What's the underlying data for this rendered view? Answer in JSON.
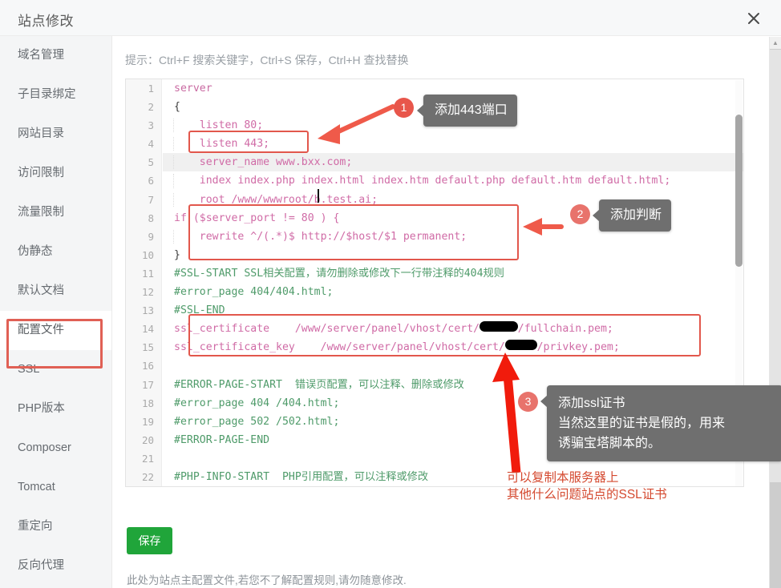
{
  "window": {
    "title": "站点修改",
    "close_icon": "close-icon"
  },
  "sidebar": {
    "items": [
      {
        "label": "域名管理",
        "active": false
      },
      {
        "label": "子目录绑定",
        "active": false
      },
      {
        "label": "网站目录",
        "active": false
      },
      {
        "label": "访问限制",
        "active": false
      },
      {
        "label": "流量限制",
        "active": false
      },
      {
        "label": "伪静态",
        "active": false
      },
      {
        "label": "默认文档",
        "active": false
      },
      {
        "label": "配置文件",
        "active": true
      },
      {
        "label": "SSL",
        "active": false
      },
      {
        "label": "PHP版本",
        "active": false
      },
      {
        "label": "Composer",
        "active": false
      },
      {
        "label": "Tomcat",
        "active": false
      },
      {
        "label": "重定向",
        "active": false
      },
      {
        "label": "反向代理",
        "active": false
      }
    ]
  },
  "main": {
    "hint": "提示：Ctrl+F 搜索关键字，Ctrl+S 保存，Ctrl+H 查找替换",
    "save_label": "保存",
    "footer_note": "此处为站点主配置文件,若您不了解配置规则,请勿随意修改."
  },
  "editor": {
    "active_line": 5,
    "line_numbers": [
      1,
      2,
      3,
      4,
      5,
      6,
      7,
      8,
      9,
      10,
      11,
      12,
      13,
      14,
      15,
      16,
      17,
      18,
      19,
      20,
      21,
      22
    ],
    "lines": [
      "server",
      "{",
      "    listen 80;",
      "    listen 443;",
      "    server_name www.bxx.com;",
      "    index index.php index.html index.htm default.php default.htm default.html;",
      "    root /www/wwwroot/b.test.ai;",
      "if ($server_port != 80 ) {",
      "    rewrite ^/(.*)$ http://$host/$1 permanent;",
      "}",
      "#SSL-START SSL相关配置，请勿删除或修改下一行带注释的404规则",
      "#error_page 404/404.html;",
      "#SSL-END",
      "ssl_certificate    /www/server/panel/vhost/cert/██████/fullchain.pem;",
      "ssl_certificate_key    /www/server/panel/vhost/cert/█████/privkey.pem;",
      "",
      "#ERROR-PAGE-START  错误页配置，可以注释、删除或修改",
      "#error_page 404 /404.html;",
      "#error_page 502 /502.html;",
      "#ERROR-PAGE-END",
      "",
      "#PHP-INFO-START  PHP引用配置，可以注释或修改"
    ]
  },
  "annotations": {
    "callouts": [
      {
        "number": "1",
        "text": "添加443端口"
      },
      {
        "number": "2",
        "text": "添加判断"
      },
      {
        "number": "3",
        "text": "添加ssl证书\n当然这里的证书是假的，用来\n诱骗宝塔脚本的。"
      }
    ],
    "handwritten_note": "可以复制本服务器上\n其他什么问题站点的SSL证书"
  },
  "colors": {
    "accent_red": "#e2574c",
    "badge_red": "#e8564b",
    "save_green": "#20a53a",
    "bubble_gray": "#6f6f6f",
    "note_orange": "#d4492f"
  }
}
